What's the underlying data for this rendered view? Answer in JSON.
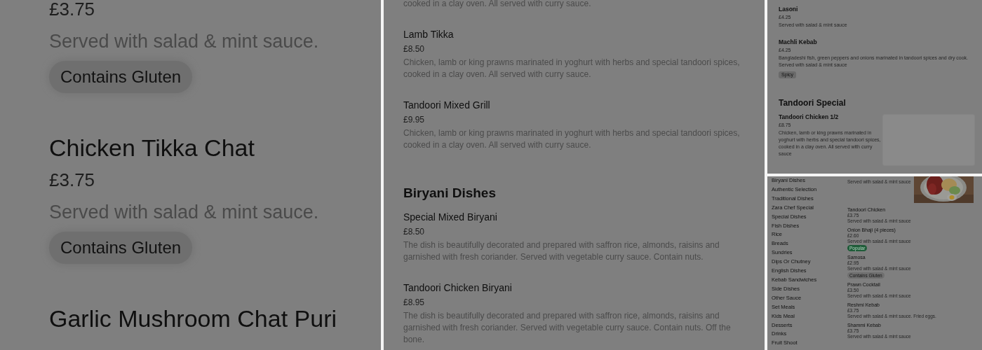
{
  "panels": [
    {
      "kind": "zoom",
      "entries": [
        {
          "kind": "item",
          "price": "£3.75",
          "description": "Served with salad & mint sauce.",
          "tags": [
            {
              "label": "Contains Gluten",
              "kind": "plain"
            }
          ]
        },
        {
          "kind": "item",
          "name": "Chicken Tikka Chat",
          "price": "£3.75",
          "description": "Served with salad & mint sauce.",
          "tags": [
            {
              "label": "Contains Gluten",
              "kind": "plain"
            }
          ]
        },
        {
          "kind": "item",
          "name": "Garlic Mushroom Chat Puri"
        }
      ]
    },
    {
      "kind": "detail",
      "entries": [
        {
          "kind": "item",
          "description": "cooked in a clay oven. All served with curry sauce."
        },
        {
          "kind": "item",
          "name": "Lamb Tikka",
          "price": "£8.50",
          "description": "Chicken, lamb or king prawns marinated in yoghurt with herbs and special tandoori spices, cooked in a clay oven. All served with curry sauce."
        },
        {
          "kind": "item",
          "name": "Tandoori Mixed Grill",
          "price": "£9.95",
          "description": "Chicken, lamb or king prawns marinated in yoghurt with herbs and special tandoori spices, cooked in a clay oven. All served with curry sauce."
        },
        {
          "kind": "heading",
          "title": "Biryani Dishes"
        },
        {
          "kind": "item",
          "name": "Special Mixed Biryani",
          "price": "£8.50",
          "description": "The dish is beautifully decorated and prepared with saffron rice, almonds, raisins and garnished with fresh coriander. Served with vegetable curry sauce. Contain nuts."
        },
        {
          "kind": "item",
          "name": "Tandoori Chicken Biryani",
          "price": "£8.95",
          "description": "The dish is beautifully decorated and prepared with saffron rice, almonds, raisins and garnished with fresh coriander. Served with vegetable curry sauce. Contain nuts. Off the bone."
        }
      ]
    },
    {
      "kind": "compact",
      "entries": [
        {
          "kind": "item",
          "name": "Lasoni",
          "price": "£4.25",
          "description": "Served with salad & mint sauce"
        },
        {
          "kind": "item",
          "name": "Machli Kebab",
          "price": "£4.25",
          "description": "Bangladeshi fish, green peppers and onions marinated in tandoori spices and dry cook. Served with salad & mint sauce",
          "tags": [
            {
              "label": "Spicy",
              "kind": "plain"
            }
          ]
        },
        {
          "kind": "heading",
          "title": "Tandoori Special"
        },
        {
          "kind": "item",
          "name": "Tandoori Chicken 1/2",
          "price": "£8.75",
          "description": "Chicken, lamb or king prawns marinated in yoghurt with herbs and special tandoori spices, cooked in a clay oven. All served with curry sauce",
          "image": {
            "kind": "placeholder"
          }
        }
      ]
    },
    {
      "kind": "overview",
      "categories": [
        "Biryani Dishes",
        "Authentic Selection",
        "Traditional Dishes",
        "Zara Chef Special",
        "Special Dishes",
        "Fish Dishes",
        "Rice",
        "Breads",
        "Sundries",
        "Dips Or Chutney",
        "English Dishes",
        "Kebab Sandwiches",
        "Side Dishes",
        "Other Sauce",
        "Set Meals",
        "Kids Meal",
        "Desserts",
        "Drinks",
        "Fruit Shoot"
      ],
      "entries": [
        {
          "kind": "item",
          "description": "Served with salad & mint sauce"
        },
        {
          "kind": "item",
          "name": "Tandoori Chicken",
          "price": "£3.75",
          "description": "Served with salad & mint sauce"
        },
        {
          "kind": "item",
          "name": "Onion Bhaji (4 pieces)",
          "price": "£2.60",
          "description": "Served with salad & mint sauce",
          "tags": [
            {
              "label": "Popular",
              "kind": "popular"
            }
          ]
        },
        {
          "kind": "item",
          "name": "Samosa",
          "price": "£2.95",
          "description": "Served with salad & mint sauce",
          "tags": [
            {
              "label": "Contains Gluten",
              "kind": "plain"
            }
          ]
        },
        {
          "kind": "item",
          "name": "Prawn Cocktail",
          "price": "£3.50",
          "description": "Served with salad & mint sauce"
        },
        {
          "kind": "item",
          "name": "Reshmi Kebab",
          "price": "£3.75",
          "description": "Served with salad & mint sauce. Fried eggs."
        },
        {
          "kind": "item",
          "name": "Shammi Kebab",
          "price": "£3.75",
          "description": "Served with salad & mint sauce"
        }
      ]
    }
  ]
}
